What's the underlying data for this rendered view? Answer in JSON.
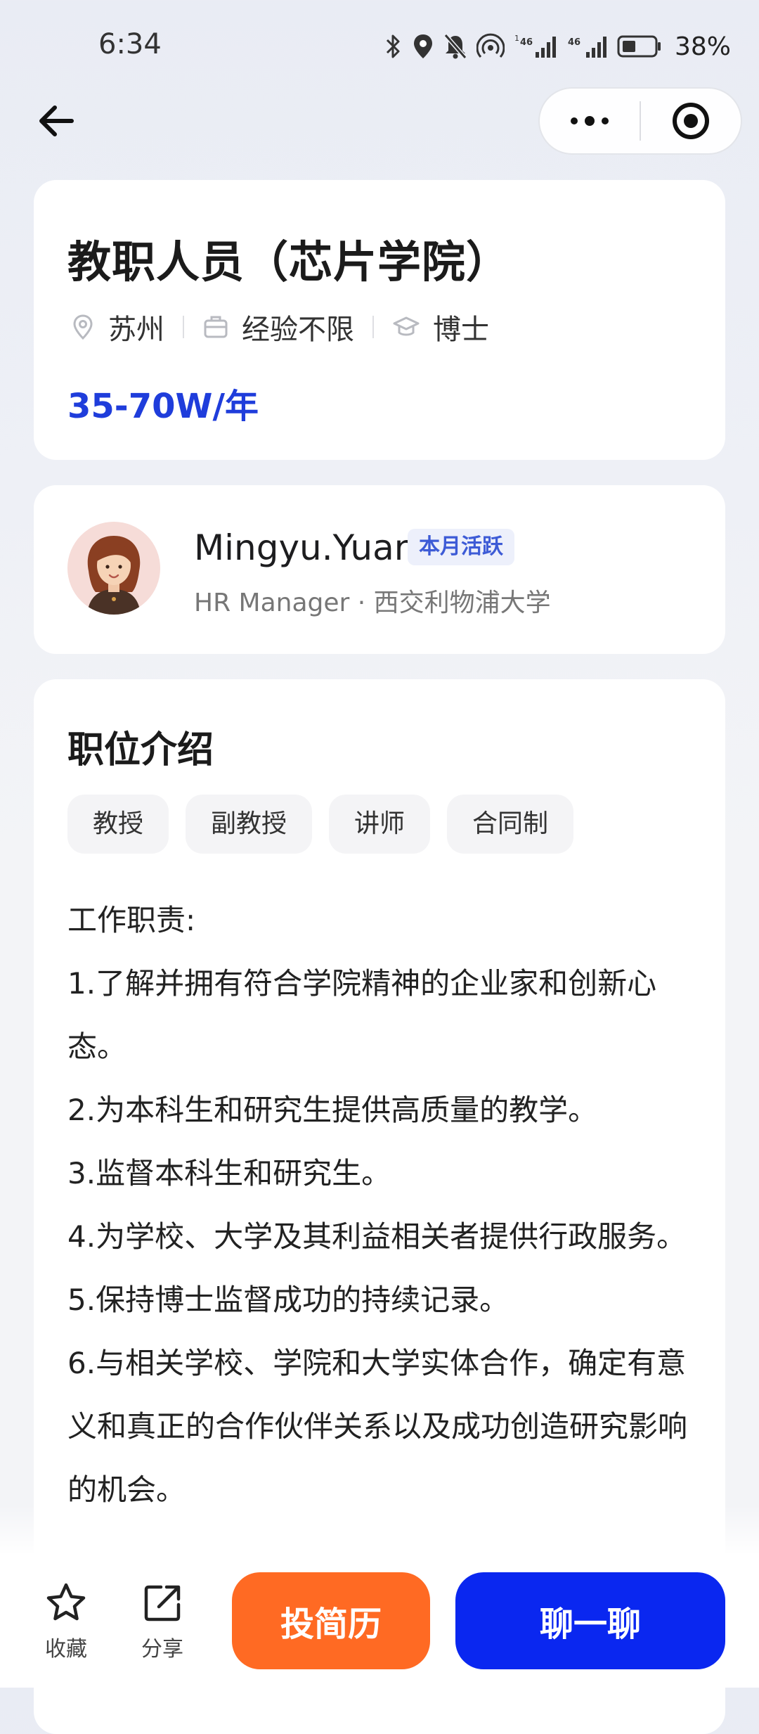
{
  "status_bar": {
    "time": "6:34",
    "battery": "38%",
    "net1": "46",
    "net2": "46",
    "sim1": "1"
  },
  "nav": {
    "back_icon": "arrow-left-icon",
    "more_icon": "ellipsis-icon",
    "close_icon": "target-close-icon"
  },
  "job": {
    "title": "教职人员（芯片学院）",
    "location": "苏州",
    "experience": "经验不限",
    "education": "博士",
    "salary": "35-70W/年"
  },
  "hr": {
    "name": "Mingyu.Yuan",
    "badge": "本月活跃",
    "subtitle": "HR Manager · 西交利物浦大学"
  },
  "description": {
    "section_title": "职位介绍",
    "tags": [
      "教授",
      "副教授",
      "讲师",
      "合同制"
    ],
    "lines": [
      "工作职责:",
      "1.了解并拥有符合学院精神的企业家和创新心态。",
      "2.为本科生和研究生提供高质量的教学。",
      "3.监督本科生和研究生。",
      "4.为学校、大学及其利益相关者提供行政服务。",
      "5.保持博士监督成功的持续记录。",
      "6.与相关学校、学院和大学实体合作，确定有意义和真正的合作伙伴关系以及成功创造研究影响的机会。"
    ]
  },
  "bottom_bar": {
    "favorite_label": "收藏",
    "share_label": "分享",
    "apply_label": "投简历",
    "chat_label": "聊一聊"
  },
  "colors": {
    "salary": "#1f3ddb",
    "apply": "#ff6a23",
    "chat": "#0a27f0",
    "badge_text": "#3d5bd6"
  }
}
